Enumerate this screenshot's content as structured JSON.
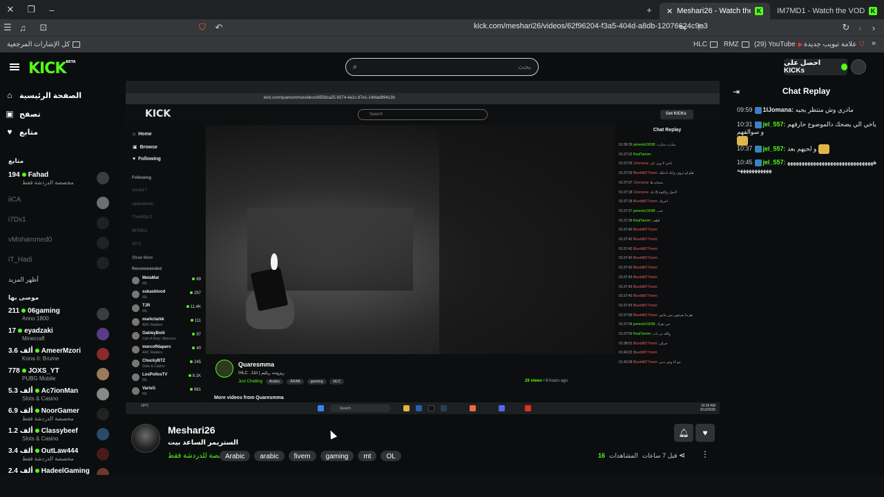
{
  "browser": {
    "tabs": [
      {
        "title": "Meshari26 - Watch the VOD o",
        "active": true
      },
      {
        "title": "IM7MD1 - Watch the VOD on Kick",
        "active": false
      }
    ],
    "url": "kick.com/meshari26/videos/62f96204-f3a5-404d-a8db-12076624c9e3",
    "bookmarks_left": "كل الإشارات المرجعية",
    "bookmarks_right": [
      {
        "label": "HLC",
        "type": "folder"
      },
      {
        "label": "RMZ",
        "type": "folder"
      },
      {
        "label": "(29) YouTube",
        "type": "link"
      },
      {
        "label": "علامة تبويب جديدة",
        "type": "link"
      }
    ]
  },
  "header": {
    "logo": "KICK",
    "logo_beta": "BETA",
    "search_placeholder": "بحث",
    "get_kicks": "احصل على KICKs"
  },
  "sidebar": {
    "nav": [
      {
        "label": "الصفحة الرئيسية",
        "icon": "home-icon"
      },
      {
        "label": "تصفح",
        "icon": "browse-icon"
      },
      {
        "label": "متابع",
        "icon": "heart-icon"
      }
    ],
    "following_title": "متابع",
    "following": [
      {
        "name": "Fahad",
        "viewers": "194",
        "sub": "مخصصة الدردشة فقط",
        "live": true
      },
      {
        "name": "iiCA",
        "live": false
      },
      {
        "name": "i7Dx1",
        "live": false
      },
      {
        "name": "vMohammed0",
        "live": false
      },
      {
        "name": "iT_Hadi",
        "live": false
      }
    ],
    "show_more": "أظهر المزيد",
    "recommended_title": "موصى بها",
    "recommended": [
      {
        "name": "06gaming",
        "viewers": "211",
        "sub": "Anno 1800"
      },
      {
        "name": "eyadzaki",
        "viewers": "17",
        "sub": "Minecraft"
      },
      {
        "name": "AmeerMzori",
        "viewers": "3.6 ألف",
        "sub": "Kona II: Brume"
      },
      {
        "name": "JOXS_YT",
        "viewers": "778",
        "sub": "PUBG Mobile"
      },
      {
        "name": "Ac7ionMan",
        "viewers": "5.3 ألف",
        "sub": "Slots & Casino"
      },
      {
        "name": "NoorGamer",
        "viewers": "6.9 ألف",
        "sub": "مخصصة الدردشة فقط"
      },
      {
        "name": "Classybeef",
        "viewers": "1.2 ألف",
        "sub": "Slots & Casino"
      },
      {
        "name": "OutLaw444",
        "viewers": "3.4 ألف",
        "sub": "مخصصة الدردشة فقط"
      },
      {
        "name": "HadeelGaming",
        "viewers": "2.4 ألف",
        "sub": ""
      }
    ]
  },
  "video": {
    "inner_url": "kick.com/quaresmma/videos/8558ca25-9374-4a1c-87e1-14bfad89413b",
    "inner_logo": "KICK",
    "inner_search": "Search",
    "inner_get_kicks": "Get KICKs",
    "inner_nav": [
      "Home",
      "Browse",
      "Following"
    ],
    "inner_following_label": "Following",
    "inner_following": [
      "Annw1T",
      "ogabaiubeh",
      "TheWitty21",
      "IM7MD1",
      "ii07X"
    ],
    "inner_show_more": "Show More",
    "inner_recommended_label": "Recommended",
    "inner_recommended": [
      {
        "name": "MetaMat",
        "sub": "IRL",
        "count": "69"
      },
      {
        "name": "sukasblood",
        "sub": "IRL",
        "count": "257"
      },
      {
        "name": "TJR",
        "sub": "IRL",
        "count": "11.4K"
      },
      {
        "name": "markclarkk",
        "sub": "ARC Raiders",
        "count": "111"
      },
      {
        "name": "OakleyBoiii",
        "sub": "Call of Duty: Warzone",
        "count": "97"
      },
      {
        "name": "mercoffdaperc",
        "sub": "ARC Raiders",
        "count": "40"
      },
      {
        "name": "ChuckyBTZ",
        "sub": "Slots & Casino",
        "count": "245"
      },
      {
        "name": "LosPollosTV",
        "sub": "IRL",
        "count": "8.1K"
      },
      {
        "name": "VarisG",
        "sub": "IRL",
        "count": "981"
      }
    ],
    "inner_streamer": "Quaresmma",
    "inner_title": "!HLC , 11n | ريزونت ريكيم",
    "inner_category": "Just Chatting",
    "inner_tags": [
      "Arabic",
      "ARAB",
      "gaming",
      "HLC"
    ],
    "inner_views": "29 views",
    "inner_ago": "8 hours ago",
    "inner_more": "More videos from Quaresmma",
    "inner_chat_title": "Chat Replay",
    "inner_chat": [
      {
        "time": "01:36:39",
        "user": "jameelo19098:",
        "text": "سارت سارت",
        "green": true
      },
      {
        "time": "01:37:02",
        "user": "RealTamim:",
        "text": "",
        "green": true
      },
      {
        "time": "01:37:03",
        "user": "1lJomana:",
        "text": "ياخي لا وين دان",
        "green": false
      },
      {
        "time": "01:37:03",
        "user": "Blueblt877moni:",
        "text": "هلو لو تروف وانك ادخلك",
        "green": false
      },
      {
        "time": "01:37:07",
        "user": "1lJomana:",
        "text": "شجايه ها",
        "green": false
      },
      {
        "time": "01:37:18",
        "user": "1lJomana:",
        "text": "لاحول ولاقوة إلا بك",
        "green": false
      },
      {
        "time": "01:37:18",
        "user": "Blueblt877moni:",
        "text": "اخرتك",
        "green": false
      },
      {
        "time": "01:37:27",
        "user": "jameelo19098:",
        "text": "حبـــ",
        "green": true
      },
      {
        "time": "01:37:38",
        "user": "RealTamim:",
        "text": "لطف",
        "green": true
      },
      {
        "time": "01:37:40",
        "user": "Blueblt877moni:",
        "text": "",
        "green": false
      },
      {
        "time": "01:37:42",
        "user": "Blueblt877moni:",
        "text": "",
        "green": false
      },
      {
        "time": "01:37:42",
        "user": "Blueblt877moni:",
        "text": "",
        "green": false
      },
      {
        "time": "01:37:42",
        "user": "Blueblt877moni:",
        "text": "",
        "green": false
      },
      {
        "time": "01:37:42",
        "user": "Blueblt877moni:",
        "text": "",
        "green": false
      },
      {
        "time": "01:37:43",
        "user": "Blueblt877moni:",
        "text": "",
        "green": false
      },
      {
        "time": "01:37:43",
        "user": "Blueblt877moni:",
        "text": "",
        "green": false
      },
      {
        "time": "01:37:43",
        "user": "Blueblt877moni:",
        "text": "",
        "green": false
      },
      {
        "time": "01:37:43",
        "user": "Blueblt877moni:",
        "text": "",
        "green": false
      },
      {
        "time": "01:37:56",
        "user": "Blueblt877moni:",
        "text": "هو ما يعرفون بس ماتور",
        "green": false
      },
      {
        "time": "01:37:58",
        "user": "jameelo19098:",
        "text": "حي تعرك",
        "green": true
      },
      {
        "time": "01:37:59",
        "user": "RealTamim:",
        "text": "والله نن ذاب",
        "green": true
      },
      {
        "time": "01:38:51",
        "user": "Blueblt877moni:",
        "text": "خراف",
        "green": false
      },
      {
        "time": "01:40:22",
        "user": "Blueblt877moni:",
        "text": "",
        "green": false
      },
      {
        "time": "01:40:28",
        "user": "Blueblt877moni:",
        "text": "مو انا وش ذنبي",
        "green": false
      }
    ],
    "taskbar_search": "Search",
    "weather": "19°C",
    "clock_time": "10:35 AM",
    "clock_date": "3/12/2026"
  },
  "channel": {
    "name": "Meshari26",
    "title": "الستريمر الساعد بيت",
    "category": "مخصصة للدردشة فقط",
    "tags": [
      "Arabic",
      "arabic",
      "fivem",
      "gaming",
      "mt",
      "OL"
    ],
    "views_count": "16",
    "views_label": "المشاهدات",
    "ago": "قبل 7 ساعات"
  },
  "chat": {
    "title": "Chat Replay",
    "messages": [
      {
        "time": "09:59",
        "user": "1lJomana:",
        "text": "ماذري وش منتظر يجيه",
        "color": "#e8eaec"
      },
      {
        "time": "10:31",
        "user": "jel_557:",
        "text": "ياخي الي يضحك دالموضوع حارقهم و سوالفهم",
        "color": "#53fc18"
      },
      {
        "time": "10:37",
        "user": "jel_557:",
        "text": "و لحيهم بعد",
        "color": "#53fc18"
      },
      {
        "time": "10:45",
        "user": "jel_557:",
        "text": "ههههههههههههههههههههههههههههههههههههههههههه",
        "color": "#53fc18"
      }
    ]
  }
}
